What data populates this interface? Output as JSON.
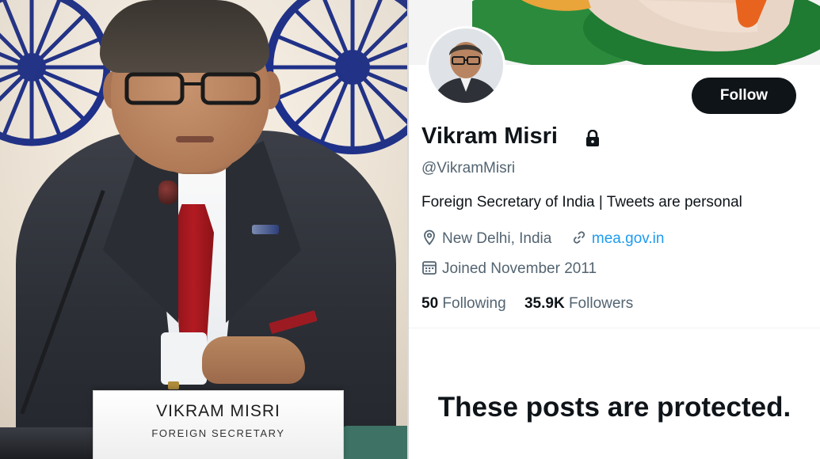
{
  "photo": {
    "nameplate": {
      "name": "VIKRAM MISRI",
      "title": "FOREIGN SECRETARY"
    }
  },
  "profile": {
    "follow_label": "Follow",
    "display_name": "Vikram Misri",
    "handle": "@VikramMisri",
    "bio": "Foreign Secretary of India | Tweets are personal",
    "location": "New Delhi, India",
    "website": "mea.gov.in",
    "joined": "Joined November 2011",
    "following_count": "50",
    "following_label": "Following",
    "followers_count": "35.9K",
    "followers_label": "Followers",
    "protected_message": "These posts are protected."
  },
  "colors": {
    "button_bg": "#0f1419",
    "secondary_text": "#536471",
    "link": "#1d9bf0",
    "chakra_blue": "#1c2f8a"
  },
  "icons": [
    "lock-icon",
    "location-pin-icon",
    "link-icon",
    "calendar-icon"
  ]
}
